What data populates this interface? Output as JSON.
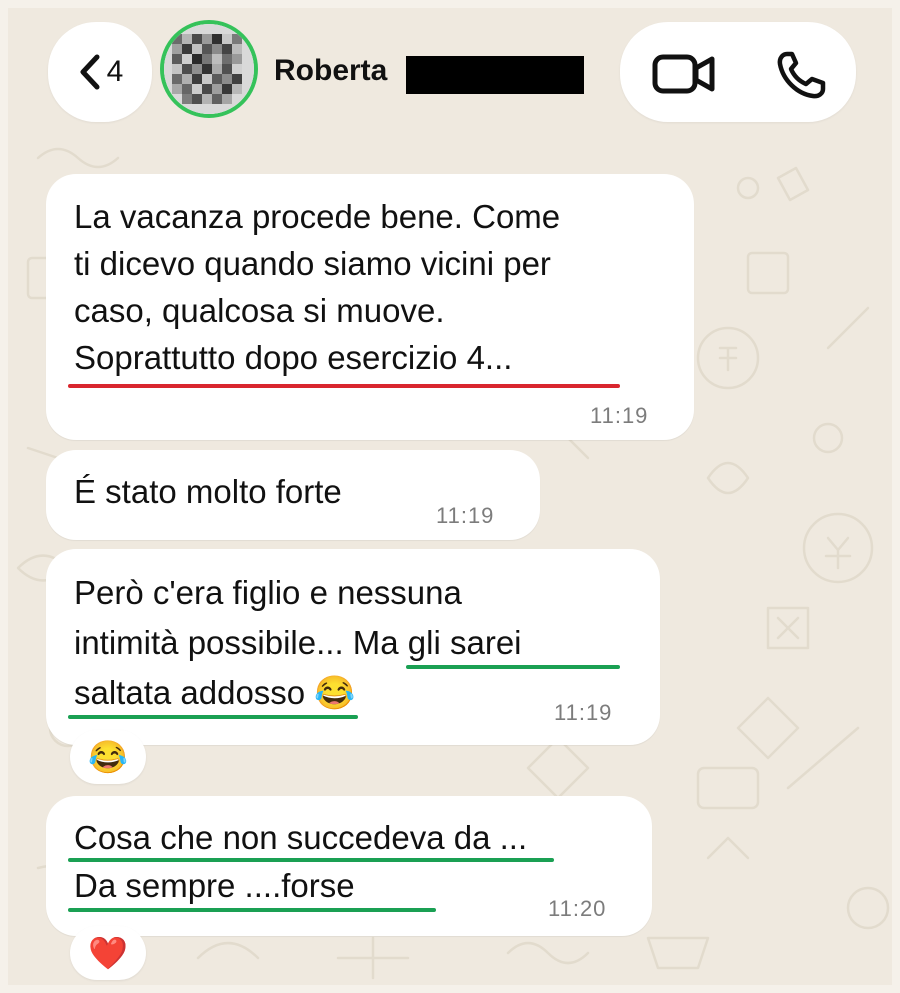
{
  "header": {
    "back_count": "4",
    "contact_name": "Roberta",
    "icons": {
      "back": "chevron-left-icon",
      "video": "video-camera-icon",
      "call": "phone-icon"
    }
  },
  "messages": [
    {
      "lines": [
        "La vacanza procede bene. Come",
        "ti dicevo quando siamo vicini per",
        "caso, qualcosa si muove.",
        "Soprattutto dopo esercizio 4..."
      ],
      "time": "11:19"
    },
    {
      "lines": [
        "É stato molto forte"
      ],
      "time": "11:19"
    },
    {
      "lines": [
        "Però c'era figlio e nessuna",
        "intimità possibile... Ma gli sarei",
        "saltata addosso 😂"
      ],
      "time": "11:19",
      "reaction": "😂"
    },
    {
      "lines": [
        "Cosa che non succedeva da ...",
        "Da sempre ....forse"
      ],
      "time": "11:20",
      "reaction": "❤️"
    }
  ],
  "colors": {
    "underline_red": "#d9262e",
    "underline_green": "#1aa053",
    "avatar_ring": "#35c25a",
    "bubble": "#ffffff",
    "wallpaper": "#efe9df"
  }
}
